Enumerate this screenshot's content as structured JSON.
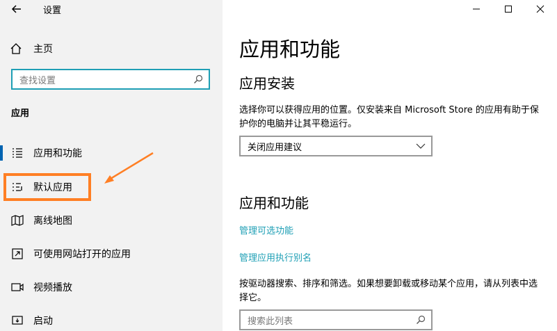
{
  "window": {
    "title": "设置"
  },
  "sidebar": {
    "home_label": "主页",
    "search_placeholder": "查找设置",
    "section_label": "应用",
    "items": [
      {
        "label": "应用和功能",
        "icon": "list-icon"
      },
      {
        "label": "默认应用",
        "icon": "default-apps-icon"
      },
      {
        "label": "离线地图",
        "icon": "map-icon"
      },
      {
        "label": "可使用网站打开的应用",
        "icon": "website-apps-icon"
      },
      {
        "label": "视频播放",
        "icon": "video-icon"
      },
      {
        "label": "启动",
        "icon": "startup-icon"
      }
    ],
    "selected_index": 0,
    "annotation_color": "#ff7f24"
  },
  "main": {
    "title": "应用和功能",
    "install_heading": "应用安装",
    "install_desc": "选择你可以获得应用的位置。仅安装来自 Microsoft Store 的应用有助于保护你的电脑并让其平稳运行。",
    "install_dropdown_value": "关闭应用建议",
    "features_heading": "应用和功能",
    "link_optional": "管理可选功能",
    "link_alias": "管理应用执行别名",
    "filter_desc": "按驱动器搜索、排序和筛选。如果想要卸载或移动某个应用，请从列表中选择它。",
    "list_search_placeholder": "搜索此列表",
    "accent_color": "#1e9fb5"
  }
}
